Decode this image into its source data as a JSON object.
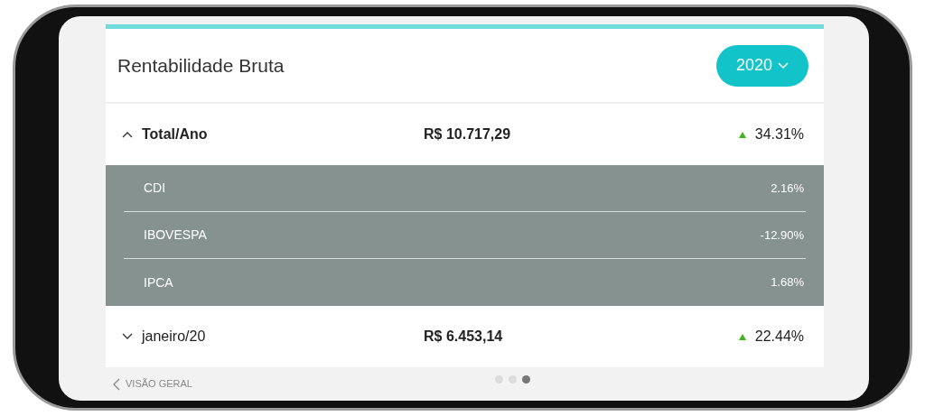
{
  "title": "Rentabilidade Bruta",
  "year_selector": {
    "value": "2020"
  },
  "rows": [
    {
      "label": "Total/Ano",
      "amount": "R$ 10.717,29",
      "change": "34.31%",
      "expanded": true,
      "children": [
        {
          "label": "CDI",
          "value": "2.16%"
        },
        {
          "label": "IBOVESPA",
          "value": "-12.90%"
        },
        {
          "label": "IPCA",
          "value": "1.68%"
        }
      ]
    },
    {
      "label": "janeiro/20",
      "amount": "R$ 6.453,14",
      "change": "22.44%",
      "expanded": false
    }
  ],
  "footer": {
    "back_link": "VISÃO GERAL"
  },
  "pager": [
    {
      "selected": false
    },
    {
      "selected": false
    },
    {
      "selected": true
    }
  ]
}
